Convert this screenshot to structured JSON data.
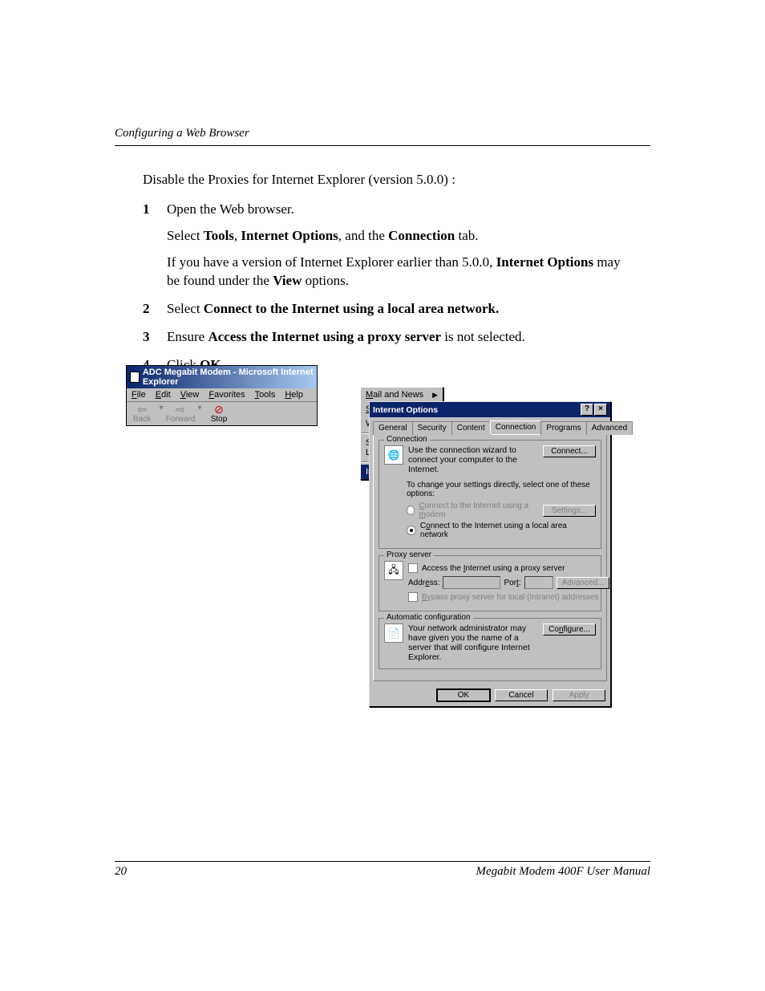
{
  "header": {
    "running_head": "Configuring a Web Browser"
  },
  "intro": "Disable the Proxies for Internet Explorer (version 5.0.0) :",
  "steps": [
    {
      "num": "1",
      "paras": [
        [
          {
            "t": "Open the Web browser."
          }
        ],
        [
          {
            "t": "Select "
          },
          {
            "t": "Tools",
            "b": true
          },
          {
            "t": ", "
          },
          {
            "t": "Internet Options",
            "b": true
          },
          {
            "t": ", and the "
          },
          {
            "t": "Connection",
            "b": true
          },
          {
            "t": " tab."
          }
        ],
        [
          {
            "t": "If you have a version of Internet Explorer earlier than 5.0.0, "
          },
          {
            "t": "Internet Options",
            "b": true
          },
          {
            "t": " may be found under the "
          },
          {
            "t": "View",
            "b": true
          },
          {
            "t": " options."
          }
        ]
      ]
    },
    {
      "num": "2",
      "paras": [
        [
          {
            "t": "Select "
          },
          {
            "t": "Connect to the Internet using a local area network.",
            "b": true
          }
        ]
      ]
    },
    {
      "num": "3",
      "paras": [
        [
          {
            "t": "Ensure "
          },
          {
            "t": "Access the Internet using a proxy server",
            "b": true
          },
          {
            "t": " is not selected."
          }
        ]
      ]
    },
    {
      "num": "4",
      "paras": [
        [
          {
            "t": "Click "
          },
          {
            "t": "OK.",
            "b": true
          }
        ]
      ]
    }
  ],
  "ie": {
    "title": "ADC  Megabit Modem - Microsoft Internet Explorer",
    "menus": [
      "File",
      "Edit",
      "View",
      "Favorites",
      "Tools",
      "Help"
    ],
    "toolbar": {
      "back": "Back",
      "forward": "Forward",
      "stop": "Stop"
    },
    "tools_menu": {
      "items": [
        "Mail and News",
        "Synchronize...",
        "Windows Update"
      ],
      "items2": [
        "Show Related Links"
      ],
      "selected": "Internet Options..."
    }
  },
  "dialog": {
    "title": "Internet Options",
    "tabs": [
      "General",
      "Security",
      "Content",
      "Connection",
      "Programs",
      "Advanced"
    ],
    "active_tab": "Connection",
    "connection": {
      "legend": "Connection",
      "text": "Use the connection wizard to connect your computer to the Internet.",
      "connect_btn": "Connect...",
      "note": "To change your settings directly, select one of these options:",
      "radio_modem": "Connect to the Internet using a modem",
      "settings_btn": "Settings...",
      "radio_lan": "Connect to the Internet using a local area network"
    },
    "proxy": {
      "legend": "Proxy server",
      "check": "Access the Internet using a proxy server",
      "address": "Address:",
      "port": "Port:",
      "advanced_btn": "Advanced...",
      "bypass": "Bypass proxy server for local (Intranet) addresses"
    },
    "auto": {
      "legend": "Automatic configuration",
      "text": "Your network administrator may have given you the name of a server that will configure Internet Explorer.",
      "configure_btn": "Configure..."
    },
    "buttons": {
      "ok": "OK",
      "cancel": "Cancel",
      "apply": "Apply"
    }
  },
  "footer": {
    "page": "20",
    "manual": "Megabit Modem 400F User Manual"
  }
}
